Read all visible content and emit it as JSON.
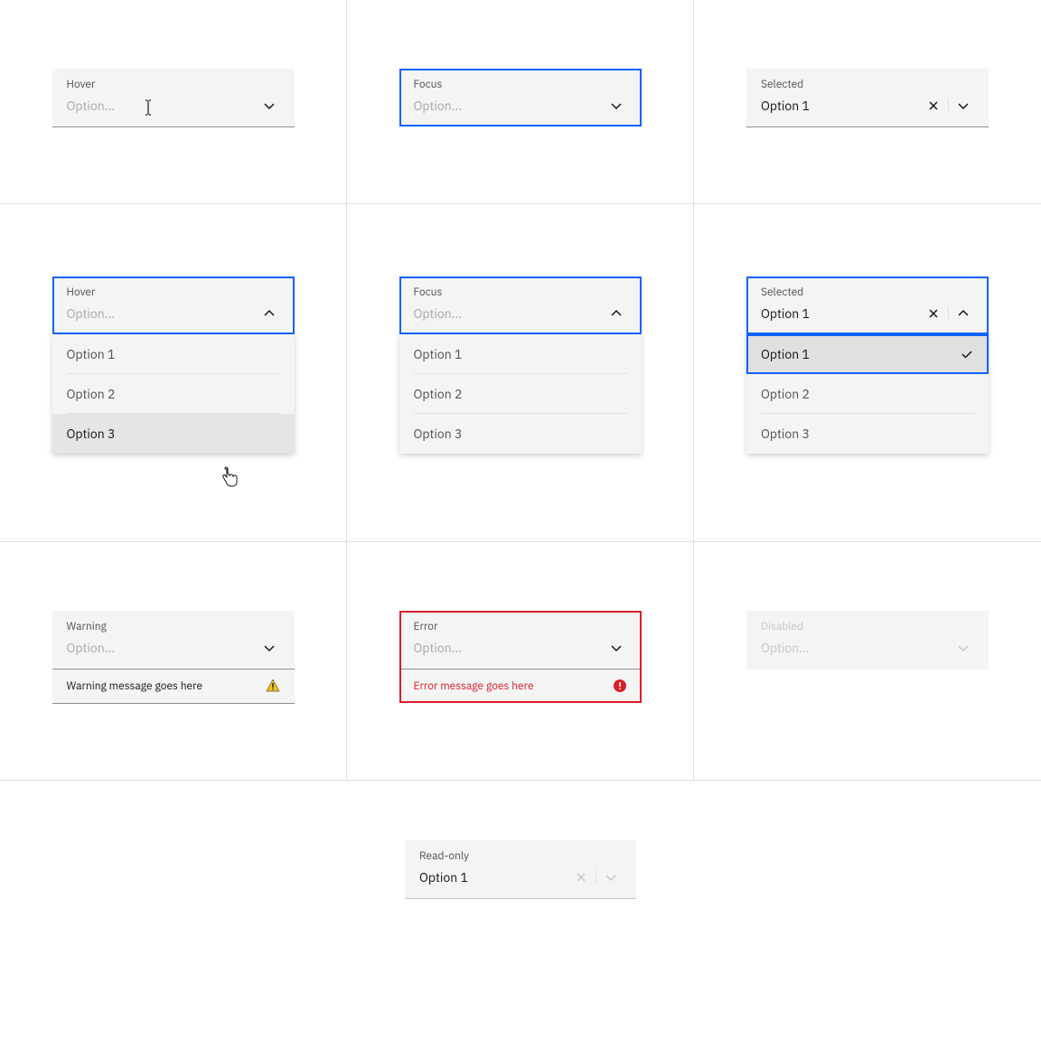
{
  "states": {
    "hover": {
      "label": "Hover",
      "placeholder": "Option..."
    },
    "focus": {
      "label": "Focus",
      "placeholder": "Option..."
    },
    "selected": {
      "label": "Selected",
      "value": "Option 1"
    },
    "hover_open": {
      "label": "Hover",
      "placeholder": "Option...",
      "options": [
        "Option 1",
        "Option 2",
        "Option 3"
      ],
      "hovered_index": 2
    },
    "focus_open": {
      "label": "Focus",
      "placeholder": "Option...",
      "options": [
        "Option 1",
        "Option 2",
        "Option 3"
      ]
    },
    "selected_open": {
      "label": "Selected",
      "value": "Option 1",
      "options": [
        "Option 1",
        "Option 2",
        "Option 3"
      ],
      "selected_index": 0
    },
    "warning": {
      "label": "Warning",
      "placeholder": "Option...",
      "message": "Warning message goes here"
    },
    "error": {
      "label": "Error",
      "placeholder": "Option...",
      "message": "Error message goes here"
    },
    "disabled": {
      "label": "Disabled",
      "placeholder": "Option..."
    },
    "readonly": {
      "label": "Read-only",
      "value": "Option 1"
    }
  }
}
